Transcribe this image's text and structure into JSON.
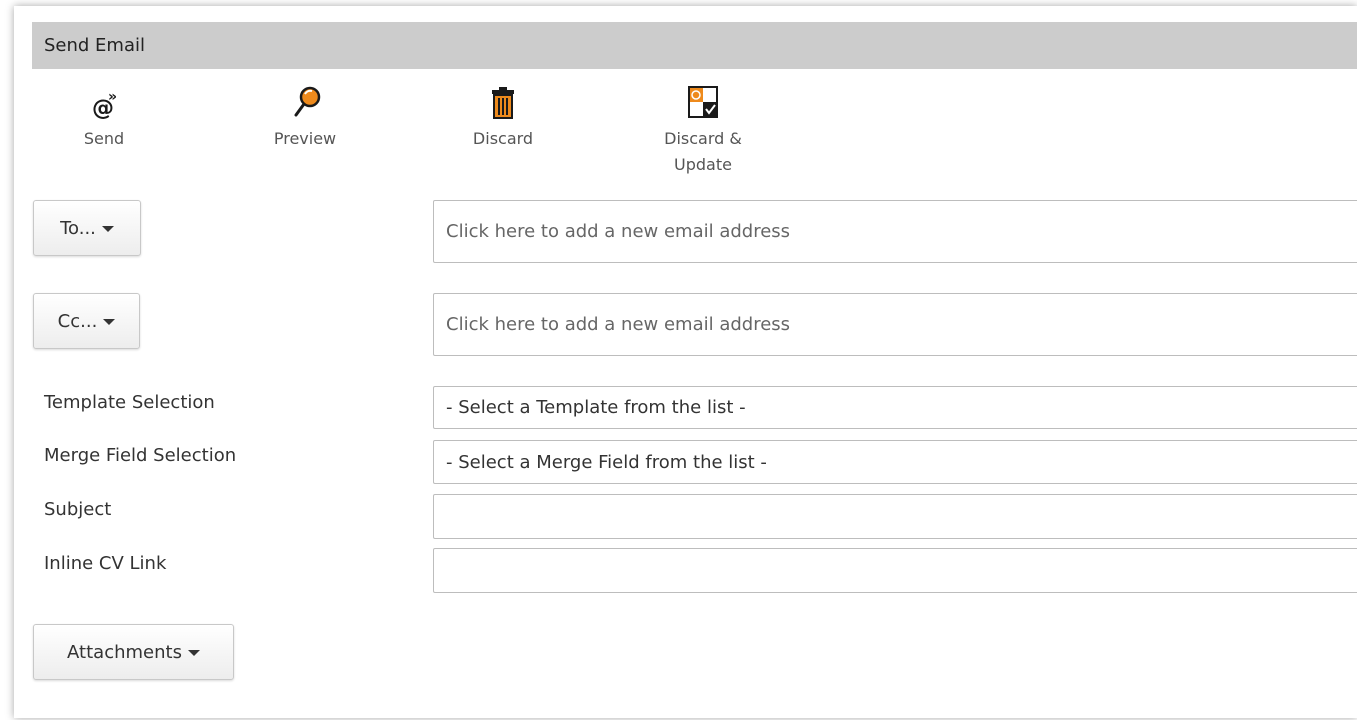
{
  "panel": {
    "title": "Send Email"
  },
  "toolbar": {
    "send_label": "Send",
    "preview_label": "Preview",
    "discard_label": "Discard",
    "discard_update_line1": "Discard &",
    "discard_update_line2": "Update"
  },
  "recipients": {
    "to_label": "To...",
    "cc_label": "Cc...",
    "to_placeholder": "Click here to add a new email address",
    "cc_placeholder": "Click here to add a new email address"
  },
  "fields": {
    "template_label": "Template Selection",
    "template_value": "- Select a Template from the list -",
    "merge_label": "Merge Field Selection",
    "merge_value": "- Select a Merge Field from the list -",
    "subject_label": "Subject",
    "subject_value": "",
    "inline_cv_label": "Inline CV Link",
    "inline_cv_value": ""
  },
  "attachments": {
    "label": "Attachments"
  },
  "colors": {
    "accent_orange": "#ee8a1c",
    "header_grey": "#cccccc",
    "icon_dark": "#1a1a1a"
  },
  "icons": {
    "send": "at-send-icon",
    "preview": "magnifier-icon",
    "discard": "trash-icon",
    "discard_update": "discard-update-icon"
  }
}
